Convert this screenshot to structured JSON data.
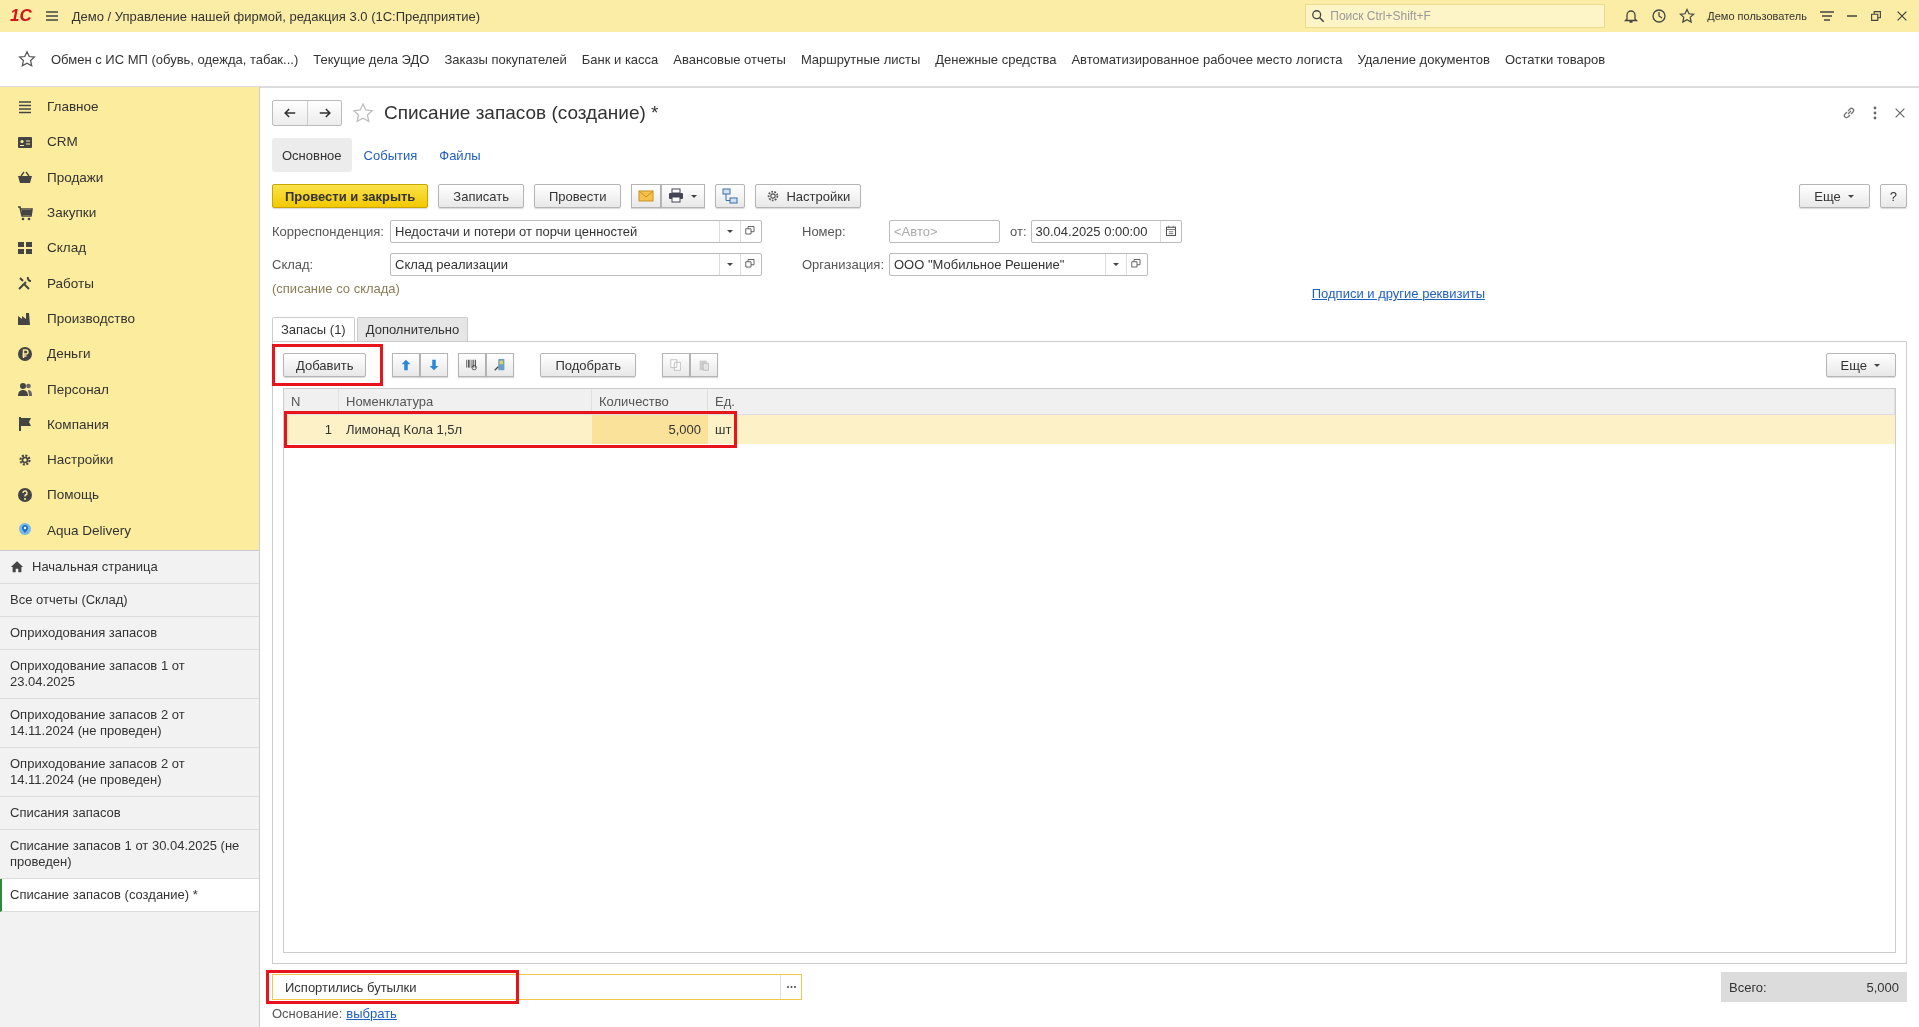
{
  "app_bar": {
    "logo": "1С",
    "title": "Демо / Управление нашей фирмой, редакция 3.0  (1С:Предприятие)",
    "search": {
      "placeholder": "Поиск Ctrl+Shift+F"
    },
    "user": "Демо пользователь"
  },
  "favorites": [
    "Обмен с ИС МП (обувь, одежда, табак...)",
    "Текущие дела ЭДО",
    "Заказы покупателей",
    "Банк и касса",
    "Авансовые отчеты",
    "Маршрутные листы",
    "Денежные средства",
    "Автоматизированное рабочее место логиста",
    "Удаление документов",
    "Остатки товаров"
  ],
  "sidebar": {
    "sections": [
      "Главное",
      "CRM",
      "Продажи",
      "Закупки",
      "Склад",
      "Работы",
      "Производство",
      "Деньги",
      "Персонал",
      "Компания",
      "Настройки",
      "Помощь",
      "Aqua Delivery"
    ],
    "open_windows": [
      {
        "label": "Начальная страница",
        "kind": "home",
        "selected": false
      },
      {
        "label": "Все отчеты (Склад)",
        "kind": "page",
        "selected": false
      },
      {
        "label": "Оприходования запасов",
        "kind": "page",
        "selected": false
      },
      {
        "label": "Оприходование запасов 1 от 23.04.2025",
        "kind": "page",
        "selected": false
      },
      {
        "label": "Оприходование запасов 2 от 14.11.2024 (не проведен)",
        "kind": "page",
        "selected": false
      },
      {
        "label": "Оприходование запасов 2 от 14.11.2024 (не проведен)",
        "kind": "page",
        "selected": false
      },
      {
        "label": "Списания запасов",
        "kind": "page",
        "selected": false
      },
      {
        "label": "Списание запасов 1 от 30.04.2025 (не проведен)",
        "kind": "page",
        "selected": false
      },
      {
        "label": "Списание запасов (создание) *",
        "kind": "page",
        "selected": true
      }
    ]
  },
  "form": {
    "title": "Списание запасов (создание) *",
    "tabs": [
      {
        "label": "Основное",
        "selected": true
      },
      {
        "label": "События",
        "selected": false
      },
      {
        "label": "Файлы",
        "selected": false
      }
    ],
    "commands": [
      {
        "label": "Провести и закрыть",
        "kind": "primary"
      },
      {
        "label": "Записать",
        "kind": "button"
      },
      {
        "label": "Провести",
        "kind": "button"
      },
      {
        "kind": "mail-print"
      },
      {
        "kind": "structure"
      },
      {
        "label": "Настройки",
        "kind": "settings"
      }
    ],
    "more_button": "Еще",
    "help_button": "?",
    "correspondence": {
      "label": "Корреспонденция:",
      "value": "Недостачи и потери от порчи ценностей"
    },
    "warehouse": {
      "label": "Склад:",
      "value": "Склад реализации",
      "hint": "(списание со склада)"
    },
    "number": {
      "label": "Номер:",
      "placeholder": "<Авто>"
    },
    "date": {
      "label": "от:",
      "value": "30.04.2025  0:00:00"
    },
    "organization": {
      "label": "Организация:",
      "value": "ООО \"Мобильное Решение\""
    },
    "details_link": "Подписи и другие реквизиты",
    "inner_tabs": [
      {
        "label": "Запасы (1)",
        "selected": true
      },
      {
        "label": "Дополнительно",
        "selected": false
      }
    ],
    "table": {
      "add_button": {
        "label": "Добавить",
        "highlighted": true
      },
      "pick_button": "Подобрать",
      "more_button": "Еще",
      "columns": [
        "N",
        "Номенклатура",
        "Количество",
        "Ед."
      ],
      "rows": [
        {
          "n": "1",
          "item": "Лимонад Кола 1,5л",
          "quantity": "5,000",
          "unit": "шт",
          "selected": true,
          "highlighted": true
        }
      ]
    },
    "comment": {
      "value": "Испортились бутылки",
      "highlighted": true
    },
    "total": {
      "label": "Всего:",
      "value": "5,000"
    },
    "basis": {
      "label": "Основание:",
      "link": "выбрать"
    }
  }
}
